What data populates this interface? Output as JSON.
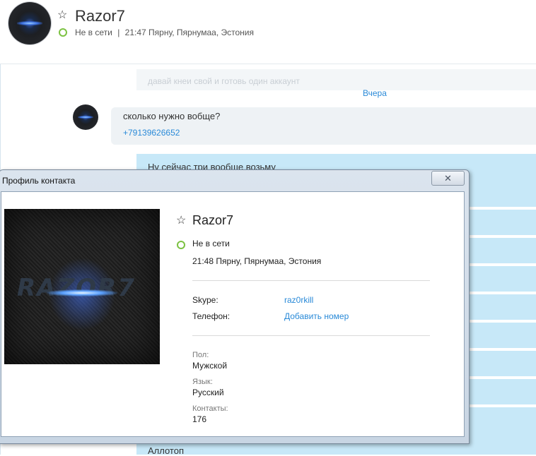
{
  "contact": {
    "name": "Razor7",
    "status": "Не в сети",
    "separator": "|",
    "time_location": "21:47 Пярну, Пярнумаа, Эстония"
  },
  "messages": {
    "faded_text": "давай кнеи свой и готовь один аккаунт",
    "date_label": "Вчера",
    "incoming_text": "сколько нужно вобще?",
    "incoming_phone": "+79139626652",
    "outgoing_first": "Ну сейчас три вообще возьму",
    "outgoing_last": "Аллотоп"
  },
  "dialog": {
    "title": "Профиль контакта",
    "close_symbol": "✕",
    "profile": {
      "picture_text": "RAZOR7",
      "name": "Razor7",
      "status": "Не в сети",
      "time_location": "21:48 Пярну, Пярнумаа, Эстония",
      "skype_label": "Skype:",
      "skype_value": "raz0rkill",
      "phone_label": "Телефон:",
      "phone_action": "Добавить номер",
      "gender_label": "Пол:",
      "gender_value": "Мужской",
      "language_label": "Язык:",
      "language_value": "Русский",
      "contacts_label": "Контакты:",
      "contacts_value": "176"
    }
  },
  "icons": {
    "star": "☆",
    "status_offline_color": "#7cc242"
  },
  "colors": {
    "accent_link": "#2a8ad8",
    "outgoing_bubble": "#c7e8f8",
    "incoming_bubble": "#eef2f5"
  }
}
